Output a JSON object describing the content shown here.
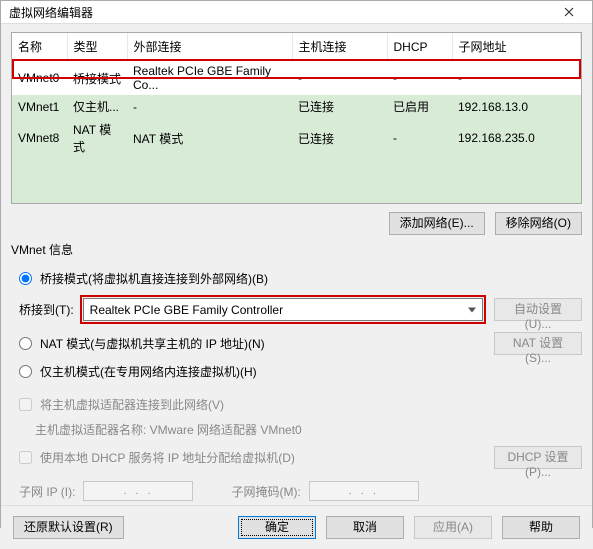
{
  "window": {
    "title": "虚拟网络编辑器"
  },
  "table": {
    "headers": [
      "名称",
      "类型",
      "外部连接",
      "主机连接",
      "DHCP",
      "子网地址"
    ],
    "rows": [
      {
        "name": "VMnet0",
        "type": "桥接模式",
        "ext": "Realtek PCIe GBE Family Co...",
        "host": "-",
        "dhcp": "-",
        "subnet": "-",
        "hl": true
      },
      {
        "name": "VMnet1",
        "type": "仅主机...",
        "ext": "-",
        "host": "已连接",
        "dhcp": "已启用",
        "subnet": "192.168.13.0",
        "hl": false
      },
      {
        "name": "VMnet8",
        "type": "NAT 模式",
        "ext": "NAT 模式",
        "host": "已连接",
        "dhcp": "-",
        "subnet": "192.168.235.0",
        "hl": false
      }
    ]
  },
  "buttons": {
    "add_net": "添加网络(E)...",
    "remove_net": "移除网络(O)",
    "auto_set": "自动设置(U)...",
    "nat_set": "NAT 设置(S)...",
    "dhcp_set": "DHCP 设置(P)...",
    "restore": "还原默认设置(R)",
    "ok": "确定",
    "cancel": "取消",
    "apply": "应用(A)",
    "help": "帮助"
  },
  "info": {
    "group_label": "VMnet 信息",
    "bridge_radio": "桥接模式(将虚拟机直接连接到外部网络)(B)",
    "bridge_to_label": "桥接到(T):",
    "bridge_to_value": "Realtek PCIe GBE Family Controller",
    "nat_radio": "NAT 模式(与虚拟机共享主机的 IP 地址)(N)",
    "hostonly_radio": "仅主机模式(在专用网络内连接虚拟机)(H)",
    "host_adapter_check": "将主机虚拟适配器连接到此网络(V)",
    "host_adapter_name_label": "主机虚拟适配器名称: VMware 网络适配器 VMnet0",
    "dhcp_check": "使用本地 DHCP 服务将 IP 地址分配给虚拟机(D)",
    "subnet_ip_label": "子网 IP (I):",
    "subnet_mask_label": "子网掩码(M):",
    "ip_placeholder": ". . ."
  }
}
